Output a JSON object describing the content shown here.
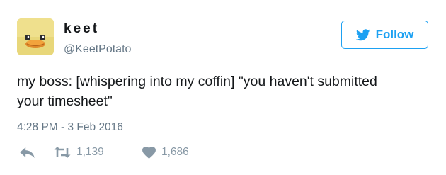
{
  "user": {
    "display_name": "keet",
    "handle": "@KeetPotato",
    "avatar_icon": "duck-avatar"
  },
  "follow_button": {
    "label": "Follow",
    "icon": "twitter-bird-icon",
    "color": "#1da1f2"
  },
  "tweet": {
    "text_line1": "my boss: [whispering into my coffin] \"you haven't submitted",
    "text_line2": "your timesheet\"",
    "timestamp": "4:28 PM - 3 Feb 2016"
  },
  "actions": {
    "reply_icon": "reply-icon",
    "retweet_icon": "retweet-icon",
    "retweet_count": "1,139",
    "like_icon": "heart-icon",
    "like_count": "1,686",
    "icon_color": "#8899a6"
  }
}
